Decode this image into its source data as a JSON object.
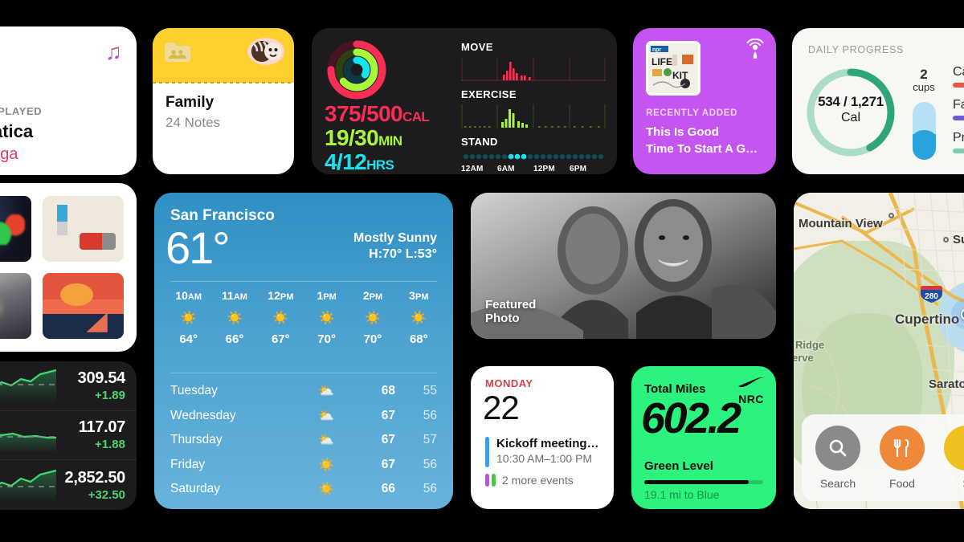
{
  "music": {
    "icon": "music-note-icon",
    "kicker": "NTLY PLAYED",
    "title": "omatica",
    "artist": "y Gaga"
  },
  "albums": {
    "name": "album-art-grid",
    "items": [
      {
        "alt": "abstract-colorful-shapes-album"
      },
      {
        "alt": "beige-car-illustration-album"
      },
      {
        "alt": "stormy-clouds-album"
      },
      {
        "alt": "sunset-sailboat-album"
      }
    ]
  },
  "stocks": {
    "rows": [
      {
        "price": "309.54",
        "change": "+1.89"
      },
      {
        "price": "117.07",
        "change": "+1.88"
      },
      {
        "price": "2,852.50",
        "change": "+32.50"
      }
    ],
    "up_color": "#4cd471"
  },
  "notes": {
    "folder_icon": "shared-folder-icon",
    "sticker_icon": "drawing-sticker-icon",
    "title": "Family",
    "subtitle": "24 Notes",
    "header_color": "#ffcf2e"
  },
  "fitness": {
    "rings_icon": "activity-rings-icon",
    "move": {
      "value": "375/500",
      "unit": "CAL",
      "color": "#fa2d55"
    },
    "exercise": {
      "value": "19/30",
      "unit": "MIN",
      "color": "#a8f73a"
    },
    "stand": {
      "value": "4/12",
      "unit": "HRS",
      "color": "#18e3f0"
    },
    "charts": [
      {
        "label": "MOVE",
        "color": "#fa2d55"
      },
      {
        "label": "EXERCISE",
        "color": "#a8f73a"
      },
      {
        "label": "STAND",
        "color": "#18e3f0"
      }
    ],
    "axis": [
      "12AM",
      "6AM",
      "12PM",
      "6PM"
    ]
  },
  "podcast": {
    "art_alt": "npr-life-kit-artwork",
    "art_brand": "npr",
    "art_line1": "LIFE",
    "art_line2": "KIT",
    "radio_icon": "podcast-radio-icon",
    "kicker": "RECENTLY ADDED",
    "title_line1": "This Is Good",
    "title_line2": "Time To Start A G…",
    "bg_color": "#c455f0"
  },
  "health": {
    "kicker": "DAILY PROGRESS",
    "ring_icon": "calorie-progress-ring",
    "calories": "534 / 1,271",
    "calorie_unit": "Cal",
    "water_count": "2",
    "water_unit": "cups",
    "water_icon": "water-glass-icon",
    "macros": [
      {
        "label": "Ca",
        "color": "#e8564a"
      },
      {
        "label": "Fa",
        "color": "#6b5bd2"
      },
      {
        "label": "Pr",
        "color": "#7fcdb0"
      }
    ],
    "ring_color": "#2fa67a"
  },
  "weather": {
    "city": "San Francisco",
    "temp": "61°",
    "condition": "Mostly Sunny",
    "high_low": "H:70°  L:53°",
    "hourly": [
      {
        "time": "10",
        "ampm": "AM",
        "icon": "sun-icon",
        "temp": "64°"
      },
      {
        "time": "11",
        "ampm": "AM",
        "icon": "sun-icon",
        "temp": "66°"
      },
      {
        "time": "12",
        "ampm": "PM",
        "icon": "sun-icon",
        "temp": "67°"
      },
      {
        "time": "1",
        "ampm": "PM",
        "icon": "sun-icon",
        "temp": "70°"
      },
      {
        "time": "2",
        "ampm": "PM",
        "icon": "sun-icon",
        "temp": "70°"
      },
      {
        "time": "3",
        "ampm": "PM",
        "icon": "sun-icon",
        "temp": "68°"
      }
    ],
    "daily": [
      {
        "day": "Tuesday",
        "icon": "sun-behind-cloud-icon",
        "high": "68",
        "low": "55"
      },
      {
        "day": "Wednesday",
        "icon": "sun-behind-cloud-icon",
        "high": "67",
        "low": "56"
      },
      {
        "day": "Thursday",
        "icon": "sun-behind-cloud-icon",
        "high": "67",
        "low": "57"
      },
      {
        "day": "Friday",
        "icon": "sun-icon",
        "high": "67",
        "low": "56"
      },
      {
        "day": "Saturday",
        "icon": "sun-icon",
        "high": "66",
        "low": "56"
      }
    ]
  },
  "photos": {
    "label_line1": "Featured",
    "label_line2": "Photo",
    "alt": "two-smiling-children-black-and-white"
  },
  "calendar": {
    "weekday": "MONDAY",
    "day_number": "22",
    "event_title": "Kickoff meeting…",
    "event_time": "10:30 AM–1:00 PM",
    "more_events": "2 more events",
    "weekday_color": "#d9414a"
  },
  "nike": {
    "label": "Total Miles",
    "brand_icon": "nike-swoosh-icon",
    "brand": "NRC",
    "miles": "602.2",
    "level": "Green Level",
    "to_next": "19.1 mi to Blue",
    "progress_pct": 88,
    "bg_color": "#2bf37d"
  },
  "maps": {
    "labels": [
      {
        "text": "Mountain View"
      },
      {
        "text": "Su"
      },
      {
        "text": "Cupertino"
      },
      {
        "text": "Saratoga"
      },
      {
        "text": "Ridge"
      },
      {
        "text": "erve"
      }
    ],
    "highway": "280",
    "user_location_icon": "user-location-dot",
    "actions": [
      {
        "label": "Search",
        "icon": "search-icon",
        "color": "#8a8a8a"
      },
      {
        "label": "Food",
        "icon": "fork-knife-icon",
        "color": "#f0883a"
      },
      {
        "label": "S",
        "icon": "gas-icon",
        "color": "#f0c020"
      }
    ]
  }
}
